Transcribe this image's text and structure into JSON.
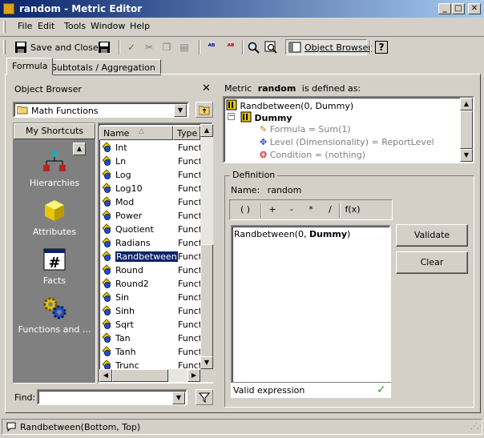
{
  "window": {
    "title": "random - Metric Editor"
  },
  "menu": [
    "File",
    "Edit",
    "Tools",
    "Window",
    "Help"
  ],
  "toolbar": {
    "save_close_label": "Save and Close",
    "object_browser_label": "Object Browser"
  },
  "tabs": [
    "Formula",
    "Subtotals / Aggregation"
  ],
  "object_browser": {
    "title": "Object Browser",
    "folder": "Math Functions",
    "shortcuts_header": "My Shortcuts",
    "shortcuts": [
      "Hierarchies",
      "Attributes",
      "Facts",
      "Functions and ..."
    ],
    "columns": [
      "Name",
      "Type"
    ],
    "items": [
      {
        "name": "Int",
        "type": "Function"
      },
      {
        "name": "Ln",
        "type": "Function"
      },
      {
        "name": "Log",
        "type": "Function"
      },
      {
        "name": "Log10",
        "type": "Function"
      },
      {
        "name": "Mod",
        "type": "Function"
      },
      {
        "name": "Power",
        "type": "Function"
      },
      {
        "name": "Quotient",
        "type": "Function"
      },
      {
        "name": "Radians",
        "type": "Function"
      },
      {
        "name": "Randbetween",
        "type": "Function"
      },
      {
        "name": "Round",
        "type": "Function"
      },
      {
        "name": "Round2",
        "type": "Function"
      },
      {
        "name": "Sin",
        "type": "Function"
      },
      {
        "name": "Sinh",
        "type": "Function"
      },
      {
        "name": "Sqrt",
        "type": "Function"
      },
      {
        "name": "Tan",
        "type": "Function"
      },
      {
        "name": "Tanh",
        "type": "Function"
      },
      {
        "name": "Trunc",
        "type": "Function"
      }
    ],
    "selected": "Randbetween",
    "find_label": "Find:",
    "find_value": ""
  },
  "metric": {
    "prefix": "Metric",
    "name": "random",
    "suffix": "is defined as:",
    "tree": {
      "root": "Randbetween(0, Dummy)",
      "child": "Dummy",
      "formula": "Formula = Sum(1)",
      "level": "Level (Dimensionality) = ReportLevel",
      "condition": "Condition = (nothing)"
    }
  },
  "definition": {
    "legend": "Definition",
    "name_label": "Name:",
    "name_value": "random",
    "operators": [
      "( )",
      "+",
      "-",
      "*",
      "/",
      "f(x)"
    ],
    "expr_prefix": "Randbetween(0, ",
    "expr_bold": "Dummy",
    "expr_suffix": ")",
    "validate_label": "Validate",
    "clear_label": "Clear",
    "status": "Valid expression"
  },
  "statusbar": {
    "text": "Randbetween(Bottom, Top)"
  },
  "colors": {
    "titlebar_start": "#0a246a",
    "titlebar_end": "#a6caf0",
    "face": "#d4d0c8",
    "selection": "#0a246a"
  }
}
